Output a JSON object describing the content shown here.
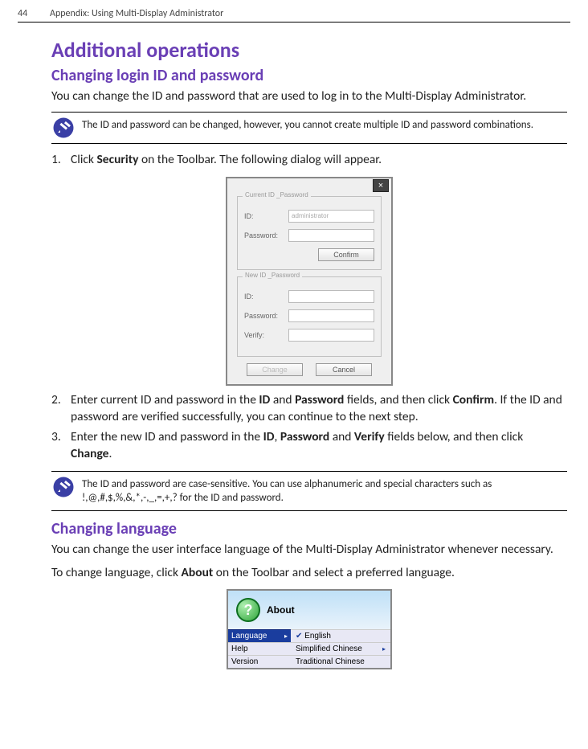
{
  "header": {
    "page_number": "44",
    "running_title": "Appendix: Using Multi-Display Administrator"
  },
  "section_title": "Additional operations",
  "subsection1": {
    "title": "Changing login ID and password",
    "intro": "You can change the ID and password that are used to log in to the Multi-Display Administrator.",
    "note1": "The ID and password can be changed, however, you cannot create multiple ID and password combinations.",
    "step1_pre": "Click ",
    "step1_bold": "Security",
    "step1_post": " on the Toolbar. The following dialog will appear.",
    "dialog": {
      "close": "×",
      "group1_title": "Current ID _Password",
      "group2_title": "New ID _Password",
      "id_label": "ID:",
      "id_value": "administrator",
      "password_label": "Password:",
      "verify_label": "Verify:",
      "confirm_btn": "Confirm",
      "change_btn": "Change",
      "cancel_btn": "Cancel"
    },
    "step2_pre": "Enter current ID and password in the ",
    "step2_b1": "ID",
    "step2_mid1": " and ",
    "step2_b2": "Password",
    "step2_mid2": " fields, and then click ",
    "step2_b3": "Confirm",
    "step2_post": ". If the ID and password are verified successfully, you can continue to the next step.",
    "step3_pre": "Enter the new ID and password in the ",
    "step3_b1": "ID",
    "step3_c1": ", ",
    "step3_b2": "Password",
    "step3_c2": " and ",
    "step3_b3": "Verify",
    "step3_c3": " fields below, and then click ",
    "step3_b4": "Change",
    "step3_post": ".",
    "note2": "The ID and password are case-sensitive. You can use alphanumeric and special characters such as !,@,#,$,%,&,*,-,_,=,+,? for the ID and password."
  },
  "subsection2": {
    "title": "Changing language",
    "p1": "You can change the user interface language of the Multi-Display Administrator whenever necessary.",
    "p2_pre": "To change language, click ",
    "p2_bold": "About",
    "p2_post": " on the Toolbar and select a preferred language.",
    "menu": {
      "about": "About",
      "language": "Language",
      "help": "Help",
      "version": "Version",
      "english": "English",
      "sc": "Simplified Chinese",
      "tc": "Traditional Chinese",
      "arrow": "▸",
      "check": "✔"
    }
  }
}
